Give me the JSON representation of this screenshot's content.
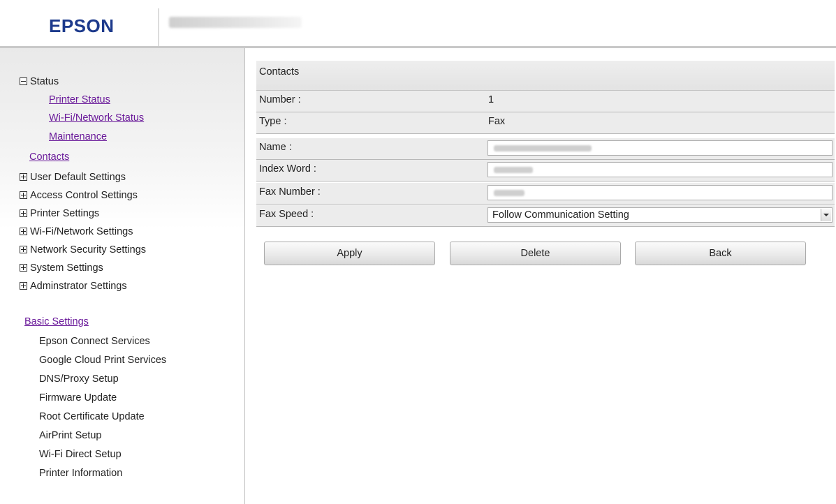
{
  "header": {
    "logo": "EPSON",
    "model_name_icon": "redacted-model-name"
  },
  "sidebar": {
    "tree": [
      {
        "label": "Status",
        "expanded": true,
        "children": [
          {
            "label": "Printer Status"
          },
          {
            "label": "Wi-Fi/Network Status"
          },
          {
            "label": "Maintenance"
          }
        ]
      },
      {
        "label": "Contacts"
      },
      {
        "label": "User Default Settings",
        "expanded": false
      },
      {
        "label": "Access Control Settings",
        "expanded": false
      },
      {
        "label": "Printer Settings",
        "expanded": false
      },
      {
        "label": "Wi-Fi/Network Settings",
        "expanded": false
      },
      {
        "label": "Network Security Settings",
        "expanded": false
      },
      {
        "label": "System Settings",
        "expanded": false
      },
      {
        "label": "Adminstrator Settings",
        "expanded": false
      }
    ],
    "basic_settings": {
      "title": "Basic Settings",
      "items": [
        "Epson Connect Services",
        "Google Cloud Print Services",
        "DNS/Proxy Setup",
        "Firmware Update",
        "Root Certificate Update",
        "AirPrint Setup",
        "Wi-Fi Direct Setup",
        "Printer Information"
      ]
    }
  },
  "form": {
    "title": "Contacts",
    "number_label": "Number :",
    "number_value": "1",
    "type_label": "Type :",
    "type_value": "Fax",
    "name_label": "Name :",
    "index_word_label": "Index Word :",
    "fax_number_label": "Fax Number :",
    "fax_speed_label": "Fax Speed :",
    "fax_speed_value": "Follow Communication Setting"
  },
  "buttons": {
    "apply": "Apply",
    "delete": "Delete",
    "back": "Back"
  },
  "colors": {
    "logo": "#1d3a8c",
    "link": "#6a1a9a"
  }
}
